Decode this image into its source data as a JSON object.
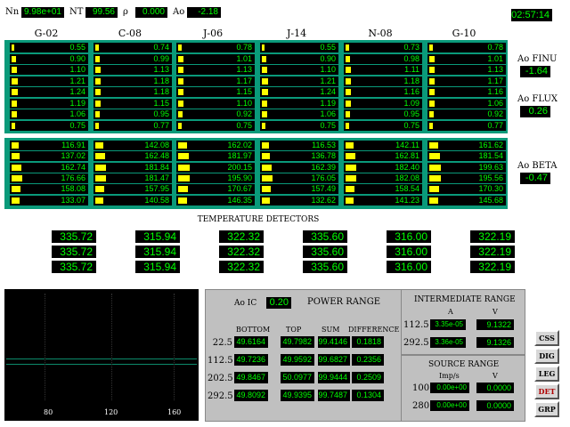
{
  "top": {
    "nn_label": "Nn",
    "nn_value": "9.98e+01",
    "nt_label": "NT",
    "nt_value": "99.56",
    "rho_label": "ρ",
    "rho_value": "0.000",
    "ao_label": "Ao",
    "ao_value": "-2.18",
    "clock": "02:57:14"
  },
  "columns": [
    "G-02",
    "C-08",
    "J-06",
    "J-14",
    "N-08",
    "G-10"
  ],
  "upper_grid": [
    [
      "0.55",
      "0.90",
      "1.10",
      "1.21",
      "1.24",
      "1.19",
      "1.06",
      "0.75"
    ],
    [
      "0.74",
      "0.99",
      "1.13",
      "1.18",
      "1.18",
      "1.15",
      "0.95",
      "0.77"
    ],
    [
      "0.78",
      "1.01",
      "1.13",
      "1.17",
      "1.15",
      "1.10",
      "0.92",
      "0.75"
    ],
    [
      "0.55",
      "0.90",
      "1.10",
      "1.21",
      "1.24",
      "1.19",
      "1.06",
      "0.75"
    ],
    [
      "0.73",
      "0.98",
      "1.11",
      "1.18",
      "1.16",
      "1.09",
      "0.95",
      "0.75"
    ],
    [
      "0.78",
      "1.01",
      "1.13",
      "1.17",
      "1.16",
      "1.06",
      "0.92",
      "0.77"
    ]
  ],
  "upper_levels": [
    [
      0.25,
      0.4,
      0.5,
      0.55,
      0.56,
      0.54,
      0.48,
      0.34
    ],
    [
      0.33,
      0.45,
      0.51,
      0.53,
      0.53,
      0.52,
      0.43,
      0.35
    ],
    [
      0.35,
      0.46,
      0.51,
      0.53,
      0.52,
      0.5,
      0.42,
      0.34
    ],
    [
      0.25,
      0.4,
      0.5,
      0.55,
      0.56,
      0.54,
      0.48,
      0.34
    ],
    [
      0.33,
      0.44,
      0.5,
      0.53,
      0.52,
      0.49,
      0.43,
      0.34
    ],
    [
      0.35,
      0.46,
      0.51,
      0.53,
      0.52,
      0.48,
      0.42,
      0.35
    ]
  ],
  "lower_grid": [
    [
      "116.91",
      "137.02",
      "162.74",
      "176.66",
      "158.08",
      "133.07"
    ],
    [
      "142.08",
      "162.48",
      "181.84",
      "181.47",
      "157.95",
      "140.58"
    ],
    [
      "162.02",
      "181.97",
      "200.15",
      "195.90",
      "170.67",
      "146.35"
    ],
    [
      "116.53",
      "136.78",
      "162.39",
      "176.05",
      "157.49",
      "132.62"
    ],
    [
      "142.11",
      "162.81",
      "182.40",
      "182.08",
      "158.54",
      "141.23"
    ],
    [
      "161.62",
      "181.54",
      "199.63",
      "195.56",
      "170.30",
      "145.68"
    ]
  ],
  "lower_levels": [
    [
      0.45,
      0.52,
      0.6,
      0.65,
      0.58,
      0.5
    ],
    [
      0.52,
      0.6,
      0.66,
      0.66,
      0.58,
      0.52
    ],
    [
      0.58,
      0.66,
      0.72,
      0.7,
      0.62,
      0.54
    ],
    [
      0.45,
      0.52,
      0.6,
      0.65,
      0.58,
      0.5
    ],
    [
      0.52,
      0.6,
      0.66,
      0.66,
      0.58,
      0.52
    ],
    [
      0.58,
      0.66,
      0.72,
      0.7,
      0.62,
      0.54
    ]
  ],
  "side": {
    "finu_label": "Ao FINU",
    "finu_value": "-1.64",
    "flux_label": "Ao FLUX",
    "flux_value": "0.26",
    "beta_label": "Ao BETA",
    "beta_value": "-0.47"
  },
  "temperature": {
    "title": "TEMPERATURE DETECTORS",
    "rows": [
      [
        "335.72",
        "315.94",
        "322.32",
        "335.60",
        "316.00",
        "322.19"
      ],
      [
        "335.72",
        "315.94",
        "322.32",
        "335.60",
        "316.00",
        "322.19"
      ],
      [
        "335.72",
        "315.94",
        "322.32",
        "335.60",
        "316.00",
        "322.19"
      ]
    ]
  },
  "trend": {
    "xticks": [
      "80",
      "120",
      "160"
    ]
  },
  "power": {
    "aoic_label": "Ao IC",
    "aoic_value": "0.20",
    "title": "POWER RANGE",
    "headers": [
      "BOTTOM",
      "TOP",
      "SUM",
      "DIFFERENCE"
    ],
    "rows": [
      {
        "label": "22.5",
        "values": [
          "49.6164",
          "49.7982",
          "99.4146",
          "0.1818"
        ]
      },
      {
        "label": "112.5",
        "values": [
          "49.7236",
          "49.9592",
          "99.6827",
          "0.2356"
        ]
      },
      {
        "label": "202.5",
        "values": [
          "49.8467",
          "50.0977",
          "99.9444",
          "0.2509"
        ]
      },
      {
        "label": "292.5",
        "values": [
          "49.8092",
          "49.9395",
          "99.7487",
          "0.1304"
        ]
      }
    ]
  },
  "intermediate": {
    "title": "INTERMEDIATE RANGE",
    "col_a": "A",
    "col_v": "V",
    "rows": [
      {
        "label": "112.5",
        "a": "3.35e-05",
        "v": "9.1322"
      },
      {
        "label": "292.5",
        "a": "3.36e-05",
        "v": "9.1326"
      }
    ]
  },
  "source": {
    "title": "SOURCE RANGE",
    "col_a": "Imp/s",
    "col_v": "V",
    "rows": [
      {
        "label": "100",
        "a": "0.00e+00",
        "v": "0.0000"
      },
      {
        "label": "280",
        "a": "0.00e+00",
        "v": "0.0000"
      }
    ]
  },
  "buttons": [
    "CSS",
    "DIG",
    "LEG",
    "DET",
    "GRP"
  ]
}
